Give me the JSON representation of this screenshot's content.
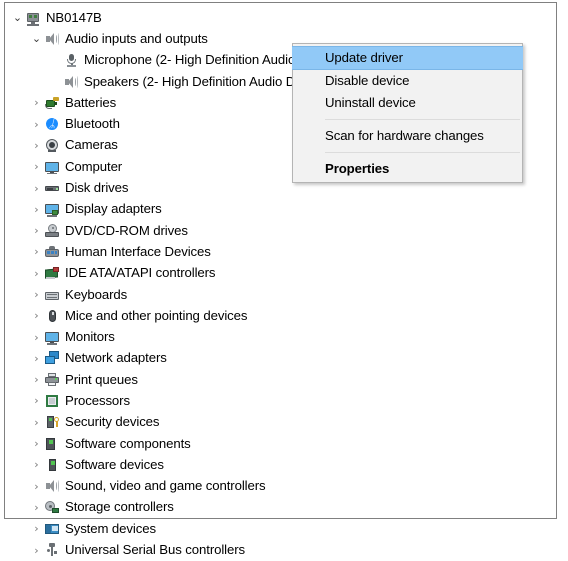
{
  "window": {
    "kind": "device-manager-tree"
  },
  "tree": {
    "root": {
      "label": "NB0147B",
      "icon": "computer-root-icon",
      "expander": "expanded"
    },
    "items": [
      {
        "label": "Audio inputs and outputs",
        "icon": "speaker-icon",
        "indent": 1,
        "expander": "expanded"
      },
      {
        "label": "Microphone (2- High Definition Audio Device)",
        "icon": "microphone-icon",
        "indent": 2,
        "expander": "none"
      },
      {
        "label": "Speakers (2- High Definition Audio Device)",
        "icon": "speaker-icon",
        "indent": 2,
        "expander": "none"
      },
      {
        "label": "Batteries",
        "icon": "battery-icon",
        "indent": 1,
        "expander": "collapsed"
      },
      {
        "label": "Bluetooth",
        "icon": "bluetooth-icon",
        "indent": 1,
        "expander": "collapsed"
      },
      {
        "label": "Cameras",
        "icon": "camera-icon",
        "indent": 1,
        "expander": "collapsed"
      },
      {
        "label": "Computer",
        "icon": "monitor-icon",
        "indent": 1,
        "expander": "collapsed"
      },
      {
        "label": "Disk drives",
        "icon": "disk-drive-icon",
        "indent": 1,
        "expander": "collapsed"
      },
      {
        "label": "Display adapters",
        "icon": "display-adapter-icon",
        "indent": 1,
        "expander": "collapsed"
      },
      {
        "label": "DVD/CD-ROM drives",
        "icon": "dvd-drive-icon",
        "indent": 1,
        "expander": "collapsed"
      },
      {
        "label": "Human Interface Devices",
        "icon": "hid-icon",
        "indent": 1,
        "expander": "collapsed"
      },
      {
        "label": "IDE ATA/ATAPI controllers",
        "icon": "ide-controller-icon",
        "indent": 1,
        "expander": "collapsed"
      },
      {
        "label": "Keyboards",
        "icon": "keyboard-icon",
        "indent": 1,
        "expander": "collapsed"
      },
      {
        "label": "Mice and other pointing devices",
        "icon": "mouse-icon",
        "indent": 1,
        "expander": "collapsed"
      },
      {
        "label": "Monitors",
        "icon": "monitor-icon",
        "indent": 1,
        "expander": "collapsed"
      },
      {
        "label": "Network adapters",
        "icon": "network-adapter-icon",
        "indent": 1,
        "expander": "collapsed"
      },
      {
        "label": "Print queues",
        "icon": "printer-icon",
        "indent": 1,
        "expander": "collapsed"
      },
      {
        "label": "Processors",
        "icon": "processor-icon",
        "indent": 1,
        "expander": "collapsed"
      },
      {
        "label": "Security devices",
        "icon": "security-device-icon",
        "indent": 1,
        "expander": "collapsed"
      },
      {
        "label": "Software components",
        "icon": "software-component-icon",
        "indent": 1,
        "expander": "collapsed"
      },
      {
        "label": "Software devices",
        "icon": "software-device-icon",
        "indent": 1,
        "expander": "collapsed"
      },
      {
        "label": "Sound, video and game controllers",
        "icon": "speaker-icon",
        "indent": 1,
        "expander": "collapsed"
      },
      {
        "label": "Storage controllers",
        "icon": "storage-controller-icon",
        "indent": 1,
        "expander": "collapsed"
      },
      {
        "label": "System devices",
        "icon": "system-device-icon",
        "indent": 1,
        "expander": "collapsed"
      },
      {
        "label": "Universal Serial Bus controllers",
        "icon": "usb-controller-icon",
        "indent": 1,
        "expander": "collapsed"
      }
    ],
    "expander_glyphs": {
      "expanded": "⌄",
      "collapsed": "›"
    }
  },
  "context_menu": {
    "items": [
      {
        "label": "Update driver",
        "highlighted": true,
        "bold": false,
        "separator_after": false
      },
      {
        "label": "Disable device",
        "highlighted": false,
        "bold": false,
        "separator_after": false
      },
      {
        "label": "Uninstall device",
        "highlighted": false,
        "bold": false,
        "separator_after": true
      },
      {
        "label": "Scan for hardware changes",
        "highlighted": false,
        "bold": false,
        "separator_after": true
      },
      {
        "label": "Properties",
        "highlighted": false,
        "bold": true,
        "separator_after": false
      }
    ]
  },
  "colors": {
    "menu_background": "#f2f2f2",
    "menu_border": "#b4b4b4",
    "highlight": "#91c9f7",
    "separator": "#dcdcdc",
    "window_border": "#808080",
    "text": "#000000",
    "expander": "#787878"
  }
}
